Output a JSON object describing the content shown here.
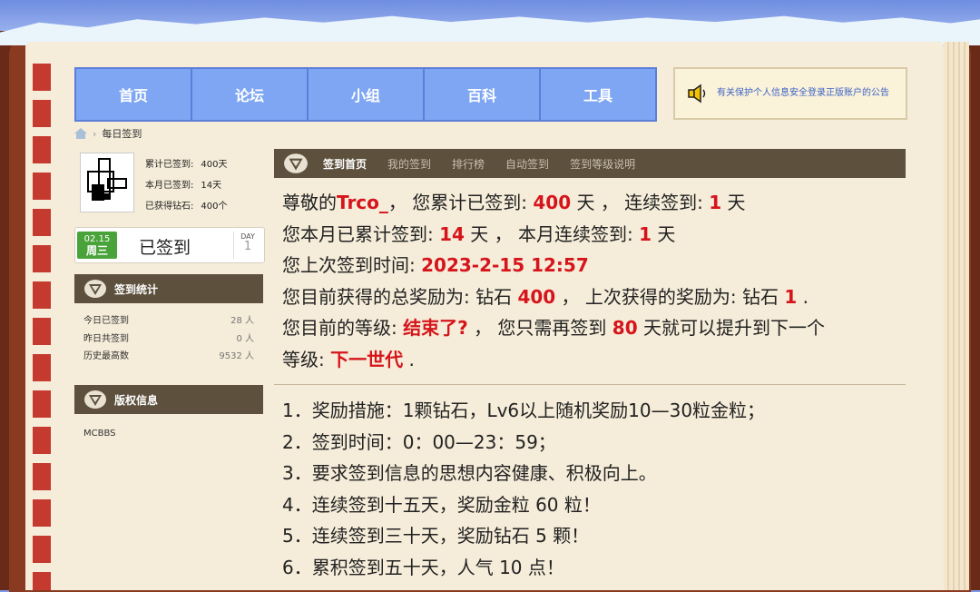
{
  "nav": [
    "首页",
    "论坛",
    "小组",
    "百科",
    "工具"
  ],
  "notice": "有关保护个人信息安全登录正版账户的公告",
  "breadcrumb": "每日签到",
  "user_stats": {
    "total_label": "累计已签到:",
    "total_value": "400天",
    "month_label": "本月已签到:",
    "month_value": "14天",
    "diamond_label": "已获得钻石:",
    "diamond_value": "400个"
  },
  "sign_button": {
    "date": "02.15",
    "weekday": "周三",
    "label": "已签到",
    "day_label": "DAY",
    "day_value": "1"
  },
  "sign_stats": {
    "title": "签到统计",
    "rows": [
      {
        "label": "今日已签到",
        "value": "28 人"
      },
      {
        "label": "昨日共签到",
        "value": "0 人"
      },
      {
        "label": "历史最高数",
        "value": "9532 人"
      }
    ]
  },
  "copyright": {
    "title": "版权信息",
    "text": "MCBBS"
  },
  "tabs": [
    "签到首页",
    "我的签到",
    "排行榜",
    "自动签到",
    "签到等级说明"
  ],
  "info": {
    "l1_a": "尊敬的",
    "username": "Trco_",
    "l1_b": "， 您累计已签到: ",
    "total_days": "400",
    "l1_c": " 天 ， 连续签到: ",
    "streak": "1",
    "l1_d": " 天",
    "l2_a": "您本月已累计签到: ",
    "month_days": "14",
    "l2_b": " 天 ， 本月连续签到: ",
    "month_streak": "1",
    "l2_c": " 天",
    "l3_a": "您上次签到时间: ",
    "last_time": "2023-2-15 12:57",
    "l4_a": "您目前获得的总奖励为: 钻石 ",
    "total_reward": "400",
    "l4_b": " ， 上次获得的奖励为: 钻石 ",
    "last_reward": "1",
    "l4_c": " .",
    "l5_a": "您目前的等级: ",
    "level": "结束了?",
    "l5_b": " ， 您只需再签到 ",
    "days_needed": "80",
    "l5_c": " 天就可以提升到下一个",
    "l6_a": "等级: ",
    "next_level": "下一世代",
    "l6_b": " ."
  },
  "rules": [
    "1．奖励措施：1颗钻石，Lv6以上随机奖励10—30粒金粒；",
    "2．签到时间：0：00—23：59；",
    "3．要求签到信息的思想内容健康、积极向上。",
    "4．连续签到十五天，奖励金粒 60 粒！",
    "5．连续签到三十天，奖励钻石 5 颗！",
    "6．累积签到五十天，人气 10 点！"
  ],
  "colors": {
    "nav_bg": "#7fa6f3",
    "panel_bg": "#5d503d",
    "highlight": "#d6141b",
    "page_bg": "#f5ecd9"
  }
}
